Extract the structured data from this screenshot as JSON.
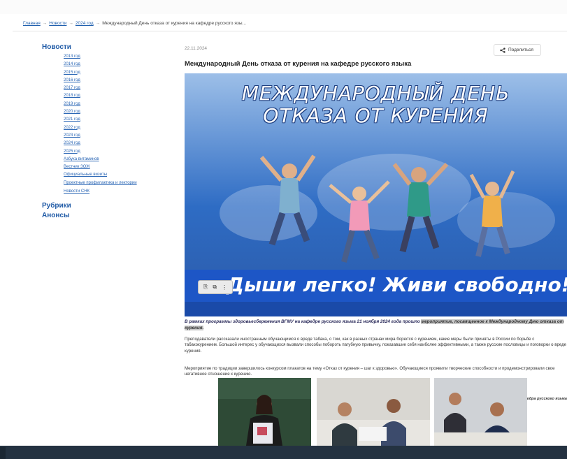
{
  "breadcrumb": {
    "items": [
      "Главная",
      "Новости",
      "2024 год"
    ],
    "current": "Международный День отказа от курения на кафедре русского язы...",
    "separator": "→"
  },
  "sidebar": {
    "news_heading": "Новости",
    "news_links": [
      "2013 год",
      "2014 год",
      "2015 год",
      "2016 год",
      "2017 год",
      "2018 год",
      "2019 год",
      "2020 год",
      "2021 год",
      "2022 год",
      "2023 год",
      "2024 год",
      "2025 год",
      "Азбука витаминов",
      "Вестник ЗОЖ",
      "Официальные визиты",
      "Проектные профилактика и лектории",
      "Новости СНК"
    ],
    "rubrics_heading": "Рубрики",
    "announcements_heading": "Анонсы"
  },
  "article": {
    "date": "22.11.2024",
    "share_label": "Поделиться",
    "share_icon": "share-icon",
    "title": "Международный День отказа от курения на кафедре русского языка",
    "banner": {
      "line1": "МЕЖДУНАРОДНЫЙ ДЕНЬ",
      "line2": "ОТКАЗА ОТ КУРЕНИЯ",
      "slogan": "Дыши легко! Живи свободно!",
      "toolbar": [
        "⎘",
        "⧉",
        "⋮"
      ]
    },
    "lead_plain": "В рамках программы здоровьесбережения ВГМУ на кафедре русского языка 21 ноября 2024 года прошло ",
    "lead_highlight": "мероприятие, посвященное к Международному Дню отказа от курения.",
    "para1": "Преподаватели рассказали иностранным обучающимся о вреде табака, о том, как в разных странах мира борются с курением, какие меры были приняты в России по борьбе с табакокурением. Большой интерес у обучающихся вызвали способы побороть пагубную привычку, показавшие себя наиболее эффективными, а также русские пословицы и поговорки о вреде курения.",
    "para2": "Мероприятие по традиции завершилось конкурсом плакатов на тему «Отказ от курения – шаг к здоровью». Обучающиеся проявили творческие способности и продемонстрировали свое негативное отношение к курению.",
    "signature": "Кафедра русского языка"
  },
  "colors": {
    "link": "#2a66b5",
    "heading": "#1f5aa6",
    "footer": "#243241",
    "banner_blue": "#1d56c6"
  }
}
